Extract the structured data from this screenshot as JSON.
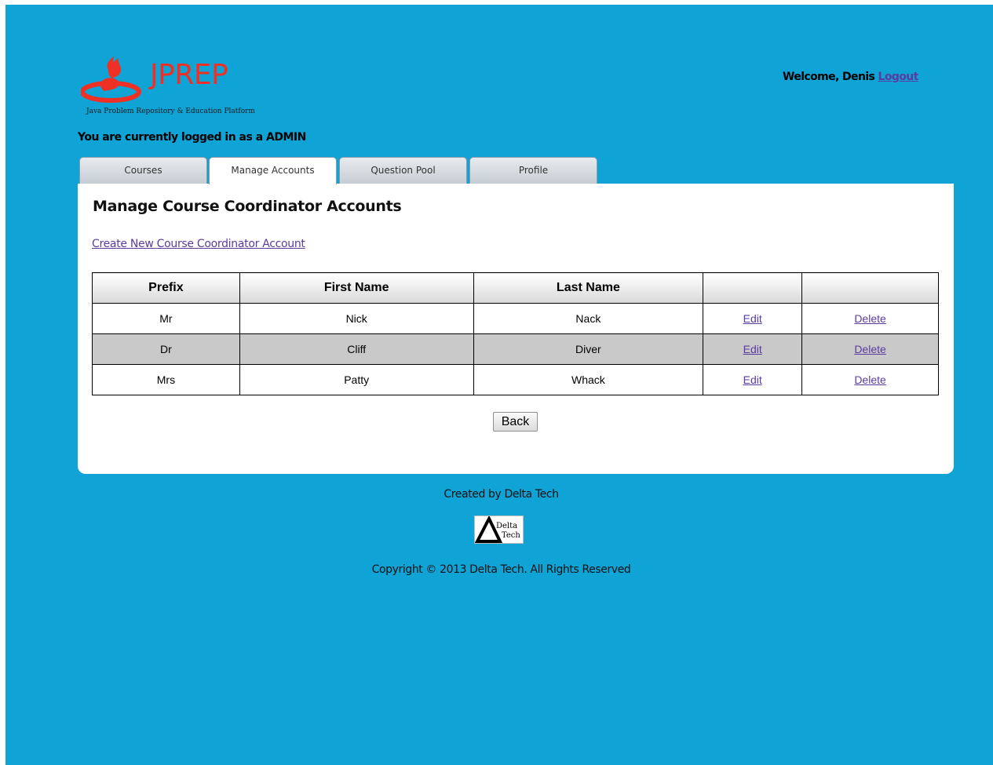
{
  "header": {
    "logo_text": "JPREP",
    "logo_tagline": "Java Problem Repository & Education Platform",
    "welcome_text": "Welcome, Denis",
    "logout_label": "Logout",
    "logged_in_text": "You are currently logged in as a ADMIN"
  },
  "tabs": [
    {
      "label": "Courses",
      "active": false
    },
    {
      "label": "Manage Accounts",
      "active": true
    },
    {
      "label": "Question Pool",
      "active": false
    },
    {
      "label": "Profile",
      "active": false
    }
  ],
  "main": {
    "title": "Manage Course Coordinator Accounts",
    "create_link": "Create New Course Coordinator Account",
    "table": {
      "columns": [
        "Prefix",
        "First Name",
        "Last Name",
        "",
        ""
      ],
      "rows": [
        {
          "prefix": "Mr",
          "first_name": "Nick",
          "last_name": "Nack",
          "edit": "Edit",
          "delete": "Delete"
        },
        {
          "prefix": "Dr",
          "first_name": "Cliff",
          "last_name": "Diver",
          "edit": "Edit",
          "delete": "Delete"
        },
        {
          "prefix": "Mrs",
          "first_name": "Patty",
          "last_name": "Whack",
          "edit": "Edit",
          "delete": "Delete"
        }
      ]
    },
    "back_label": "Back"
  },
  "footer": {
    "created_by": "Created by Delta Tech",
    "logo_word_1": "Delta",
    "logo_word_2": "Tech",
    "copyright": "Copyright © 2013 Delta Tech. All Rights Reserved"
  },
  "colors": {
    "background": "#0fa3d6",
    "logo_red": "#ee3124",
    "link": "#5a3ca0",
    "alt_row": "#c9c9c9"
  }
}
